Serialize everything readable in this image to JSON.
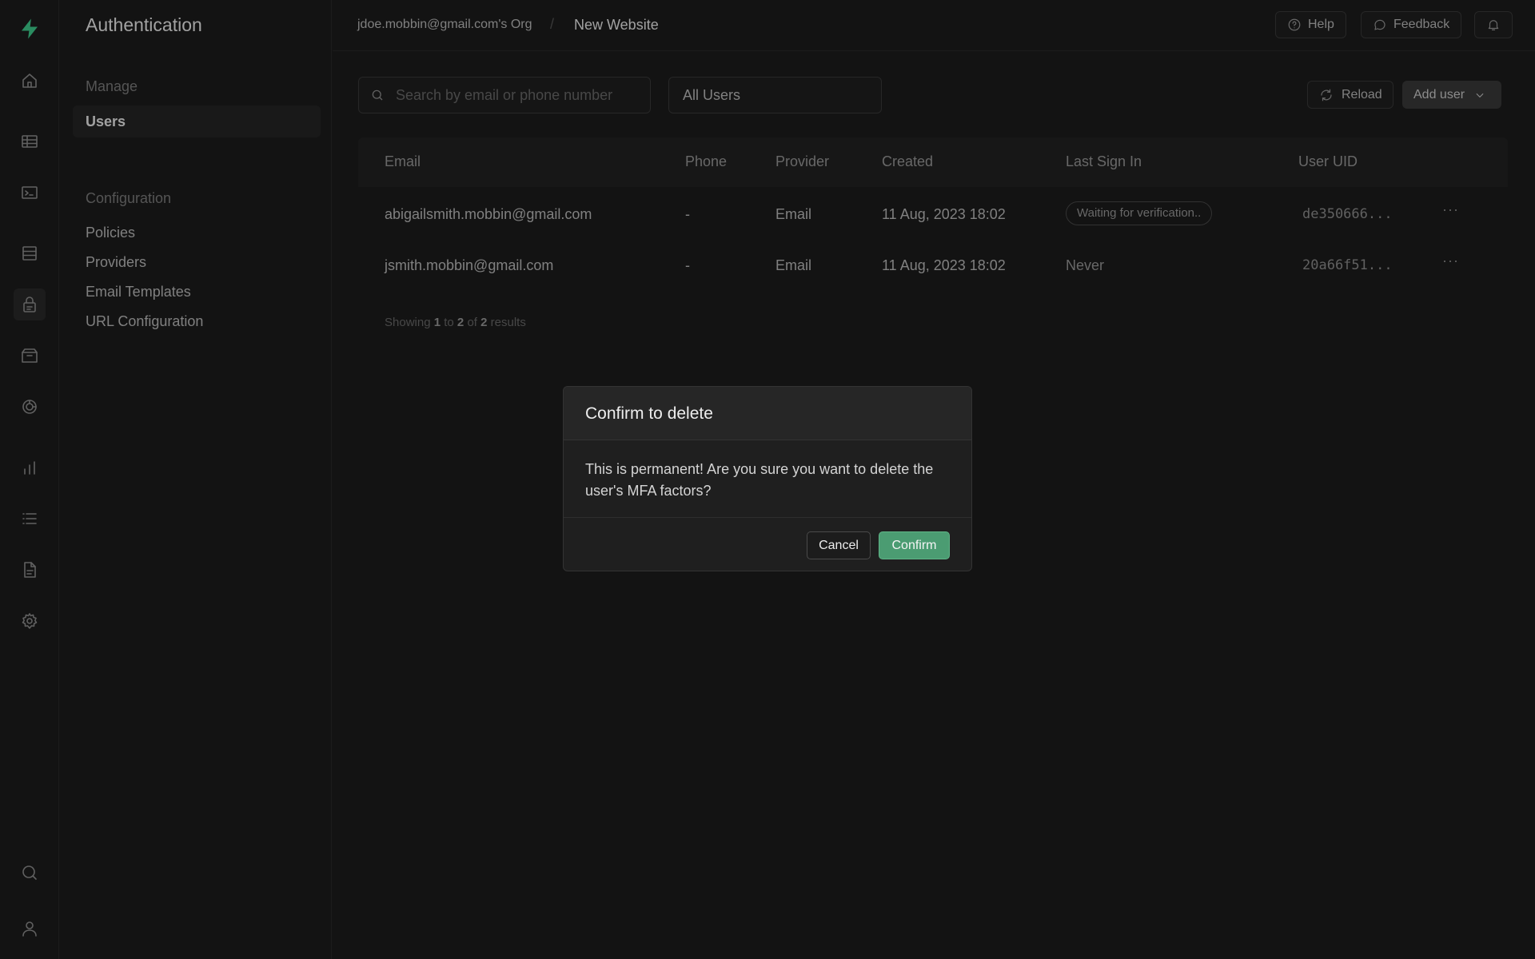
{
  "sidebar": {
    "title": "Authentication",
    "manage_label": "Manage",
    "users_label": "Users",
    "configuration_label": "Configuration",
    "items": [
      "Policies",
      "Providers",
      "Email Templates",
      "URL Configuration"
    ]
  },
  "topbar": {
    "org": "jdoe.mobbin@gmail.com's Org",
    "separator": "/",
    "project": "New Website",
    "help": "Help",
    "feedback": "Feedback"
  },
  "toolbar": {
    "search_placeholder": "Search by email or phone number",
    "filter_value": "All Users",
    "reload": "Reload",
    "add_user": "Add user"
  },
  "table": {
    "headers": [
      "Email",
      "Phone",
      "Provider",
      "Created",
      "Last Sign In",
      "User UID"
    ],
    "rows": [
      {
        "email": "abigailsmith.mobbin@gmail.com",
        "phone": "-",
        "provider": "Email",
        "created": "11 Aug, 2023 18:02",
        "last_sign_in": "Waiting for verification..",
        "uid": "de350666...",
        "more": "···"
      },
      {
        "email": "jsmith.mobbin@gmail.com",
        "phone": "-",
        "provider": "Email",
        "created": "11 Aug, 2023 18:02",
        "last_sign_in": "Never",
        "uid": "20a66f51...",
        "more": "···"
      }
    ],
    "footer": {
      "showing": "Showing",
      "from": "1",
      "to_word": "to",
      "to": "2",
      "of_word": "of",
      "total": "2",
      "results": "results"
    }
  },
  "dialog": {
    "title": "Confirm to delete",
    "message": "This is permanent! Are you sure you want to delete the user's MFA factors?",
    "cancel": "Cancel",
    "confirm": "Confirm"
  },
  "colors": {
    "brand": "#3ecf8e",
    "confirm_button": "#4b9c72",
    "background": "#1c1c1c"
  }
}
